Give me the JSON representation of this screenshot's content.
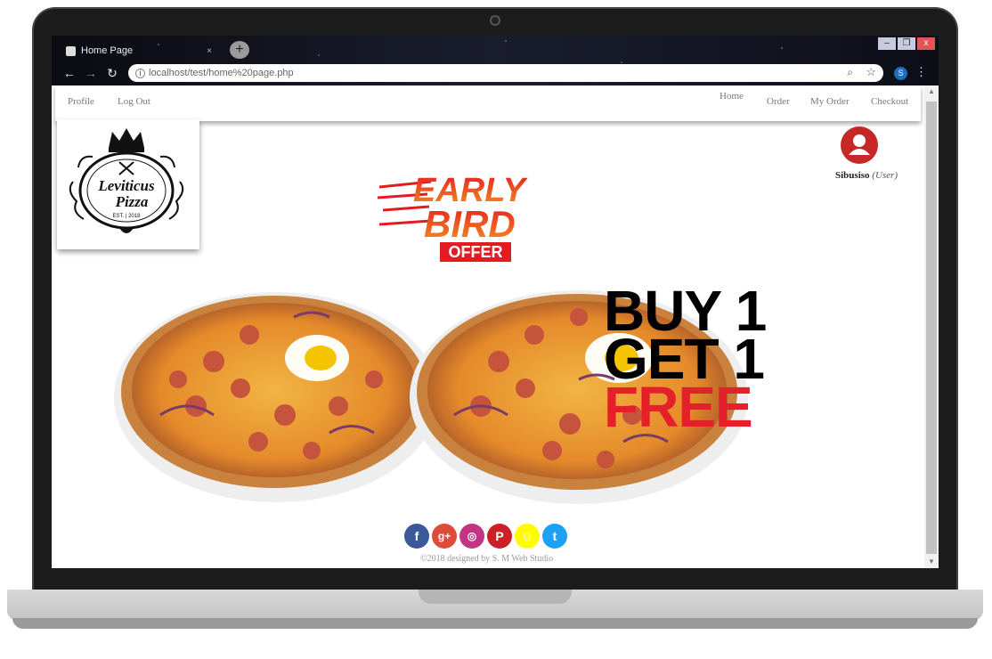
{
  "browser": {
    "tab_title": "Home Page",
    "tab_close": "×",
    "new_tab": "+",
    "url": "localhost/test/home%20page.php",
    "extension_badge": "S",
    "window_controls": {
      "minimize": "–",
      "restore": "❐",
      "close": "x"
    }
  },
  "site_nav": {
    "left": {
      "profile": "Profile",
      "logout": "Log Out"
    },
    "right": {
      "home": "Home",
      "order": "Order",
      "my_order": "My Order",
      "checkout": "Checkout"
    }
  },
  "logo": {
    "line1": "Leviticus",
    "line2": "Pizza",
    "est": "EST. | 2018"
  },
  "user": {
    "name": "Sibusiso",
    "role": "(User)"
  },
  "promo": {
    "badge_line1": "EARLY",
    "badge_line2": "BIRD",
    "badge_line3": "OFFER",
    "offer_line1": "BUY 1",
    "offer_line2": "GET 1",
    "offer_line3": "FREE"
  },
  "social": {
    "facebook": "f",
    "google_plus": "g+",
    "instagram": "◎",
    "pinterest": "P",
    "snapchat": "☺",
    "twitter": "t"
  },
  "footer": {
    "text": "©2018 designed by  S. M Web Studio"
  },
  "colors": {
    "avatar": "#c62828",
    "offer_red": "#e5202a",
    "facebook": "#3b5998",
    "google_plus": "#dd4b39",
    "instagram": "#c13584",
    "pinterest": "#cb2027",
    "snapchat": "#fffc00",
    "twitter": "#1da1f2"
  }
}
